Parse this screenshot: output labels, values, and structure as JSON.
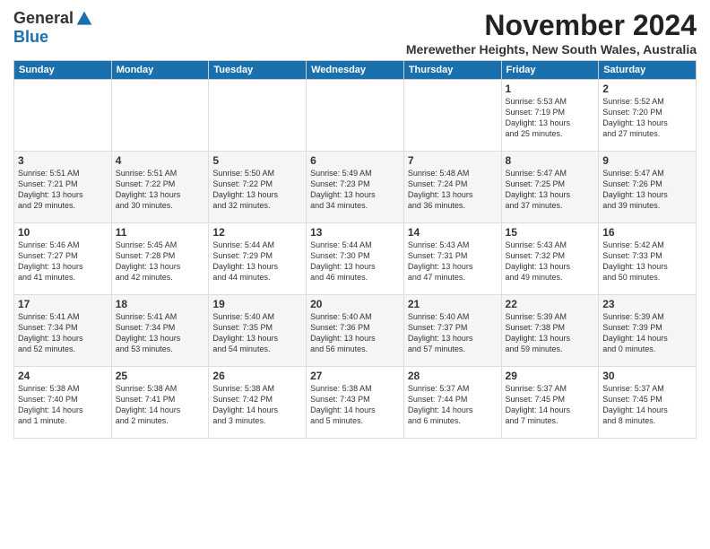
{
  "logo": {
    "general": "General",
    "blue": "Blue"
  },
  "title": "November 2024",
  "location": "Merewether Heights, New South Wales, Australia",
  "weekdays": [
    "Sunday",
    "Monday",
    "Tuesday",
    "Wednesday",
    "Thursday",
    "Friday",
    "Saturday"
  ],
  "weeks": [
    [
      {
        "day": "",
        "info": ""
      },
      {
        "day": "",
        "info": ""
      },
      {
        "day": "",
        "info": ""
      },
      {
        "day": "",
        "info": ""
      },
      {
        "day": "",
        "info": ""
      },
      {
        "day": "1",
        "info": "Sunrise: 5:53 AM\nSunset: 7:19 PM\nDaylight: 13 hours\nand 25 minutes."
      },
      {
        "day": "2",
        "info": "Sunrise: 5:52 AM\nSunset: 7:20 PM\nDaylight: 13 hours\nand 27 minutes."
      }
    ],
    [
      {
        "day": "3",
        "info": "Sunrise: 5:51 AM\nSunset: 7:21 PM\nDaylight: 13 hours\nand 29 minutes."
      },
      {
        "day": "4",
        "info": "Sunrise: 5:51 AM\nSunset: 7:22 PM\nDaylight: 13 hours\nand 30 minutes."
      },
      {
        "day": "5",
        "info": "Sunrise: 5:50 AM\nSunset: 7:22 PM\nDaylight: 13 hours\nand 32 minutes."
      },
      {
        "day": "6",
        "info": "Sunrise: 5:49 AM\nSunset: 7:23 PM\nDaylight: 13 hours\nand 34 minutes."
      },
      {
        "day": "7",
        "info": "Sunrise: 5:48 AM\nSunset: 7:24 PM\nDaylight: 13 hours\nand 36 minutes."
      },
      {
        "day": "8",
        "info": "Sunrise: 5:47 AM\nSunset: 7:25 PM\nDaylight: 13 hours\nand 37 minutes."
      },
      {
        "day": "9",
        "info": "Sunrise: 5:47 AM\nSunset: 7:26 PM\nDaylight: 13 hours\nand 39 minutes."
      }
    ],
    [
      {
        "day": "10",
        "info": "Sunrise: 5:46 AM\nSunset: 7:27 PM\nDaylight: 13 hours\nand 41 minutes."
      },
      {
        "day": "11",
        "info": "Sunrise: 5:45 AM\nSunset: 7:28 PM\nDaylight: 13 hours\nand 42 minutes."
      },
      {
        "day": "12",
        "info": "Sunrise: 5:44 AM\nSunset: 7:29 PM\nDaylight: 13 hours\nand 44 minutes."
      },
      {
        "day": "13",
        "info": "Sunrise: 5:44 AM\nSunset: 7:30 PM\nDaylight: 13 hours\nand 46 minutes."
      },
      {
        "day": "14",
        "info": "Sunrise: 5:43 AM\nSunset: 7:31 PM\nDaylight: 13 hours\nand 47 minutes."
      },
      {
        "day": "15",
        "info": "Sunrise: 5:43 AM\nSunset: 7:32 PM\nDaylight: 13 hours\nand 49 minutes."
      },
      {
        "day": "16",
        "info": "Sunrise: 5:42 AM\nSunset: 7:33 PM\nDaylight: 13 hours\nand 50 minutes."
      }
    ],
    [
      {
        "day": "17",
        "info": "Sunrise: 5:41 AM\nSunset: 7:34 PM\nDaylight: 13 hours\nand 52 minutes."
      },
      {
        "day": "18",
        "info": "Sunrise: 5:41 AM\nSunset: 7:34 PM\nDaylight: 13 hours\nand 53 minutes."
      },
      {
        "day": "19",
        "info": "Sunrise: 5:40 AM\nSunset: 7:35 PM\nDaylight: 13 hours\nand 54 minutes."
      },
      {
        "day": "20",
        "info": "Sunrise: 5:40 AM\nSunset: 7:36 PM\nDaylight: 13 hours\nand 56 minutes."
      },
      {
        "day": "21",
        "info": "Sunrise: 5:40 AM\nSunset: 7:37 PM\nDaylight: 13 hours\nand 57 minutes."
      },
      {
        "day": "22",
        "info": "Sunrise: 5:39 AM\nSunset: 7:38 PM\nDaylight: 13 hours\nand 59 minutes."
      },
      {
        "day": "23",
        "info": "Sunrise: 5:39 AM\nSunset: 7:39 PM\nDaylight: 14 hours\nand 0 minutes."
      }
    ],
    [
      {
        "day": "24",
        "info": "Sunrise: 5:38 AM\nSunset: 7:40 PM\nDaylight: 14 hours\nand 1 minute."
      },
      {
        "day": "25",
        "info": "Sunrise: 5:38 AM\nSunset: 7:41 PM\nDaylight: 14 hours\nand 2 minutes."
      },
      {
        "day": "26",
        "info": "Sunrise: 5:38 AM\nSunset: 7:42 PM\nDaylight: 14 hours\nand 3 minutes."
      },
      {
        "day": "27",
        "info": "Sunrise: 5:38 AM\nSunset: 7:43 PM\nDaylight: 14 hours\nand 5 minutes."
      },
      {
        "day": "28",
        "info": "Sunrise: 5:37 AM\nSunset: 7:44 PM\nDaylight: 14 hours\nand 6 minutes."
      },
      {
        "day": "29",
        "info": "Sunrise: 5:37 AM\nSunset: 7:45 PM\nDaylight: 14 hours\nand 7 minutes."
      },
      {
        "day": "30",
        "info": "Sunrise: 5:37 AM\nSunset: 7:45 PM\nDaylight: 14 hours\nand 8 minutes."
      }
    ]
  ]
}
